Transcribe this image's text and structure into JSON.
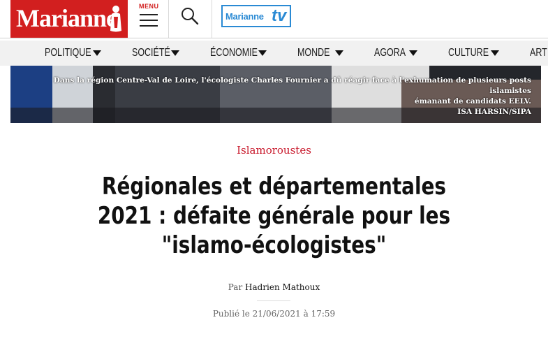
{
  "header": {
    "logo_text": "Marianne",
    "menu_label": "MENU",
    "tv_logo": {
      "brand": "Marianne",
      "suffix": "tv"
    },
    "brand_color": "#d21f1f",
    "tv_color": "#2a8ad4"
  },
  "nav": {
    "items": [
      {
        "label": "POLITIQUE"
      },
      {
        "label": "SOCIÉTÉ"
      },
      {
        "label": "ÉCONOMIE"
      },
      {
        "label": "MONDE"
      },
      {
        "label": "AGORA"
      },
      {
        "label": "CULTURE"
      },
      {
        "label": "ART D"
      }
    ],
    "chevron_icon": "triangle-down-icon"
  },
  "hero": {
    "caption_line1": "Dans la région Centre-Val de Loire, l'écologiste Charles Fournier a dû réagir face à l'exhumation de plusieurs posts islamistes",
    "caption_line2": "émanant de candidats EELV.",
    "credit": "ISA HARSIN/SIPA"
  },
  "article": {
    "kicker": "Islamoroustes",
    "title": "Régionales et départementales 2021 : défaite générale pour les \"islamo-écologistes\"",
    "by_prefix": "Par",
    "author": "Hadrien Mathoux",
    "published": "Publié le 21/06/2021 à 17:59"
  }
}
